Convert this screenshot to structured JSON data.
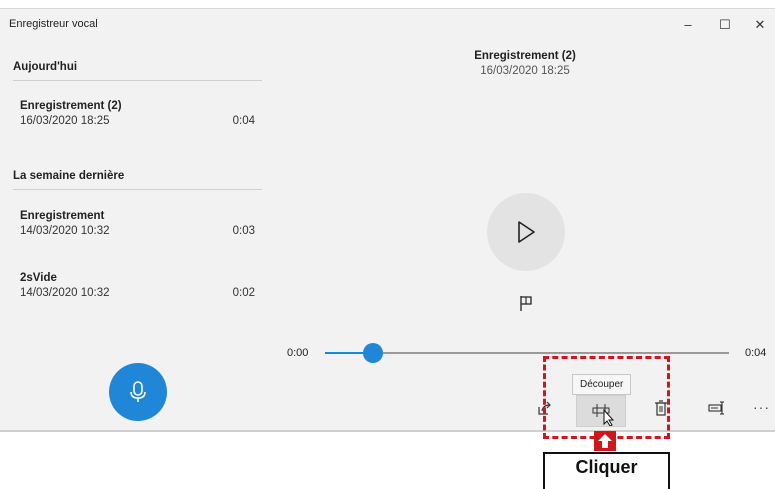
{
  "window": {
    "title": "Enregistreur vocal",
    "controls": {
      "minimize": "–",
      "maximize": "☐",
      "close": "✕"
    }
  },
  "sidebar": {
    "sections": [
      {
        "label": "Aujourd'hui"
      },
      {
        "label": "La semaine dernière"
      }
    ],
    "recordings": [
      {
        "name": "Enregistrement (2)",
        "date": "16/03/2020 18:25",
        "duration": "0:04"
      },
      {
        "name": "Enregistrement",
        "date": "14/03/2020 10:32",
        "duration": "0:03"
      },
      {
        "name": "2sVide",
        "date": "14/03/2020 10:32",
        "duration": "0:02"
      }
    ],
    "record_button_icon": "microphone-icon"
  },
  "player": {
    "title": "Enregistrement (2)",
    "date": "16/03/2020 18:25",
    "play_icon": "play-icon",
    "marker_icon": "flag-icon",
    "position_label": "0:00",
    "length_label": "0:04",
    "progress_fraction": 0.12
  },
  "toolbar": {
    "icons": [
      "share-icon",
      "trim-icon",
      "delete-icon",
      "rename-icon",
      "more-icon"
    ],
    "more_label": "···",
    "tooltip": "Découper"
  },
  "annotation": {
    "label": "Cliquer",
    "color": "#d0161b"
  },
  "colors": {
    "accent": "#1f86d8",
    "background": "#f2f2f2"
  }
}
